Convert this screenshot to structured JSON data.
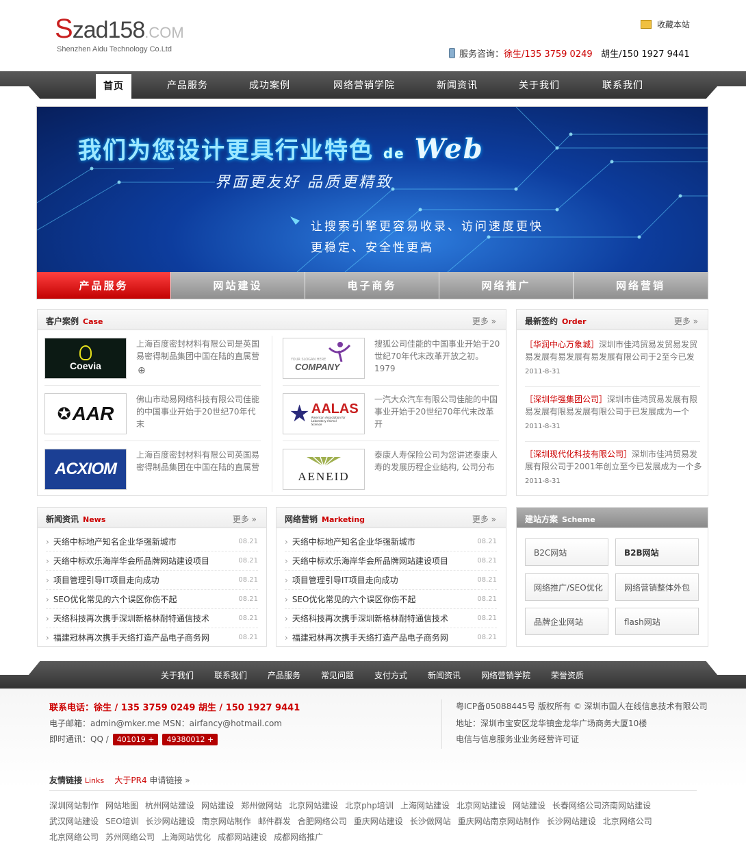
{
  "header": {
    "logo_s": "S",
    "logo_main": "zad158",
    "logo_com": ".COM",
    "logo_sub": "Shenzhen Aidu Technology Co.Ltd",
    "favorite": "收藏本站",
    "hotline_label": "服务咨询：",
    "hotline_1": "徐生/135 3759 0249",
    "hotline_2": "胡生/150 1927 9441"
  },
  "nav": [
    "首页",
    "产品服务",
    "成功案例",
    "网络营销学院",
    "新闻资讯",
    "关于我们",
    "联系我们"
  ],
  "banner": {
    "title": "我们为您设计更具行业特色",
    "title_de": "de",
    "title_web": "Web",
    "subtitle": "界面更友好  品质更精致",
    "line1": "让搜索引擎更容易收录、访问速度更快",
    "line2": "更稳定、安全性更高",
    "tabs": [
      "产品服务",
      "网站建设",
      "电子商务",
      "网络推广",
      "网络营销"
    ]
  },
  "cases": {
    "title": "客户案例",
    "title_en": "Case",
    "more": "更多 »",
    "items": [
      {
        "logo": "Coevia",
        "text": "上海百度密封材料有限公司是英国易密得制品集团中国在陆的直属营"
      },
      {
        "logo": "COMPANY",
        "logo_small": "YOUR SLOGAN HERE",
        "text": "搜狐公司佳能的中国事业开始于20世纪70年代末改革开放之初。1979"
      },
      {
        "logo": "AAR",
        "text": "佛山市动易网络科技有限公司佳能的中国事业开始于20世纪70年代末"
      },
      {
        "logo": "AALAS",
        "logo_small": "American Association for Laboratory Animal Science",
        "text": "一汽大众汽车有限公司佳能的中国事业开始于20世纪70年代末改革开"
      },
      {
        "logo": "ACXIOM",
        "text": "上海百度密封材料有限公司英国易密得制品集团在中国在陆的直属营"
      },
      {
        "logo": "AENEID",
        "text": "泰康人寿保险公司为您讲述泰康人寿的发展历程企业结构, 公司分布"
      }
    ]
  },
  "orders": {
    "title": "最新签约",
    "title_en": "Order",
    "more": "更多 »",
    "items": [
      {
        "company": "［华润中心万象城］",
        "text": "深圳市佳鸿贸易发贸易发贸易发展有易发展有易发展有限公司于2至今已发",
        "date": "2011-8-31"
      },
      {
        "company": "［深圳华强集团公司］",
        "text": "深圳市佳鸿贸易发展有限易发展有限易发展有限公司于已发展成为一个",
        "date": "2011-8-31"
      },
      {
        "company": "［深圳现代化科技有限公司］",
        "text": "深圳市佳鸿贸易发展有限公司于2001年创立至今已发展成为一个多",
        "date": "2011-8-31"
      }
    ]
  },
  "news": {
    "title": "新闻资讯",
    "title_en": "News",
    "more": "更多 »",
    "items": [
      {
        "text": "天络中标地产知名企业华强新城市",
        "date": "08.21"
      },
      {
        "text": "天络中标欢乐海岸华会所品牌网站建设项目",
        "date": "08.21"
      },
      {
        "text": "项目管理引导IT项目走向成功",
        "date": "08.21"
      },
      {
        "text": "SEO优化常见的六个误区你伤不起",
        "date": "08.21"
      },
      {
        "text": "天络科技再次携手深圳新格林耐特通信技术",
        "date": "08.21"
      },
      {
        "text": "福建冠林再次携手天络打造产品电子商务网",
        "date": "08.21"
      }
    ]
  },
  "marketing": {
    "title": "网络营销",
    "title_en": "Marketing",
    "more": "更多 »",
    "items": [
      {
        "text": "天络中标地产知名企业华强新城市",
        "date": "08.21"
      },
      {
        "text": "天络中标欢乐海岸华会所品牌网站建设项目",
        "date": "08.21"
      },
      {
        "text": "项目管理引导IT项目走向成功",
        "date": "08.21"
      },
      {
        "text": "SEO优化常见的六个误区你伤不起",
        "date": "08.21"
      },
      {
        "text": "天络科技再次携手深圳新格林耐特通信技术",
        "date": "08.21"
      },
      {
        "text": "福建冠林再次携手天络打造产品电子商务网",
        "date": "08.21"
      }
    ]
  },
  "scheme": {
    "title": "建站方案",
    "title_en": "Scheme",
    "items": [
      "B2C网站",
      "B2B网站",
      "网络推广/SEO优化",
      "网络营销整体外包",
      "品牌企业网站",
      "flash网站"
    ]
  },
  "footer_nav": [
    "关于我们",
    "联系我们",
    "产品服务",
    "常见问题",
    "支付方式",
    "新闻资讯",
    "网络营销学院",
    "荣誉资质"
  ],
  "footer": {
    "phone_label": "联系电话：",
    "phone_text": "徐生 / 135 3759 0249   胡生 / 150 1927 9441",
    "email": "电子邮箱：admin@mker.me   MSN：airfancy@hotmail.com",
    "im_label": "即时通讯：QQ /",
    "qq1": "401019 +",
    "qq2": "49380012 +",
    "icp": "粤ICP备05088445号 版权所有 © 深圳市国人在线信息技术有限公司",
    "address": "地址：深圳市宝安区龙华镇金龙华广场商务大厦10楼",
    "license": "电信与信息服务业业务经营许可证",
    "links_label": "友情链接",
    "links_en": "Links",
    "links_pr": "大于PR4",
    "links_apply": "申请链接 »",
    "links": [
      [
        "深圳网站制作",
        "网站地图",
        "杭州网站建设",
        "网站建设",
        "郑州做网站",
        "北京网站建设",
        "北京php培训",
        "上海网站建设",
        "北京网站建设",
        "网站建设",
        "长春网络公司济南网站建设"
      ],
      [
        "武汉网站建设",
        "SEO培训",
        "长沙网站建设",
        "南京网站制作",
        "邮件群发",
        "合肥网络公司",
        "重庆网站建设",
        "长沙做网站",
        "重庆网站南京网站制作",
        "长沙网站建设",
        "北京网络公司"
      ],
      [
        "北京网络公司",
        "苏州网络公司",
        "上海网站优化",
        "成都网站建设",
        "成都网络推广"
      ]
    ]
  },
  "colors": {
    "accent": "#cc0000",
    "nav_dark": "#444444",
    "banner_blue": "#0d3d9e"
  }
}
